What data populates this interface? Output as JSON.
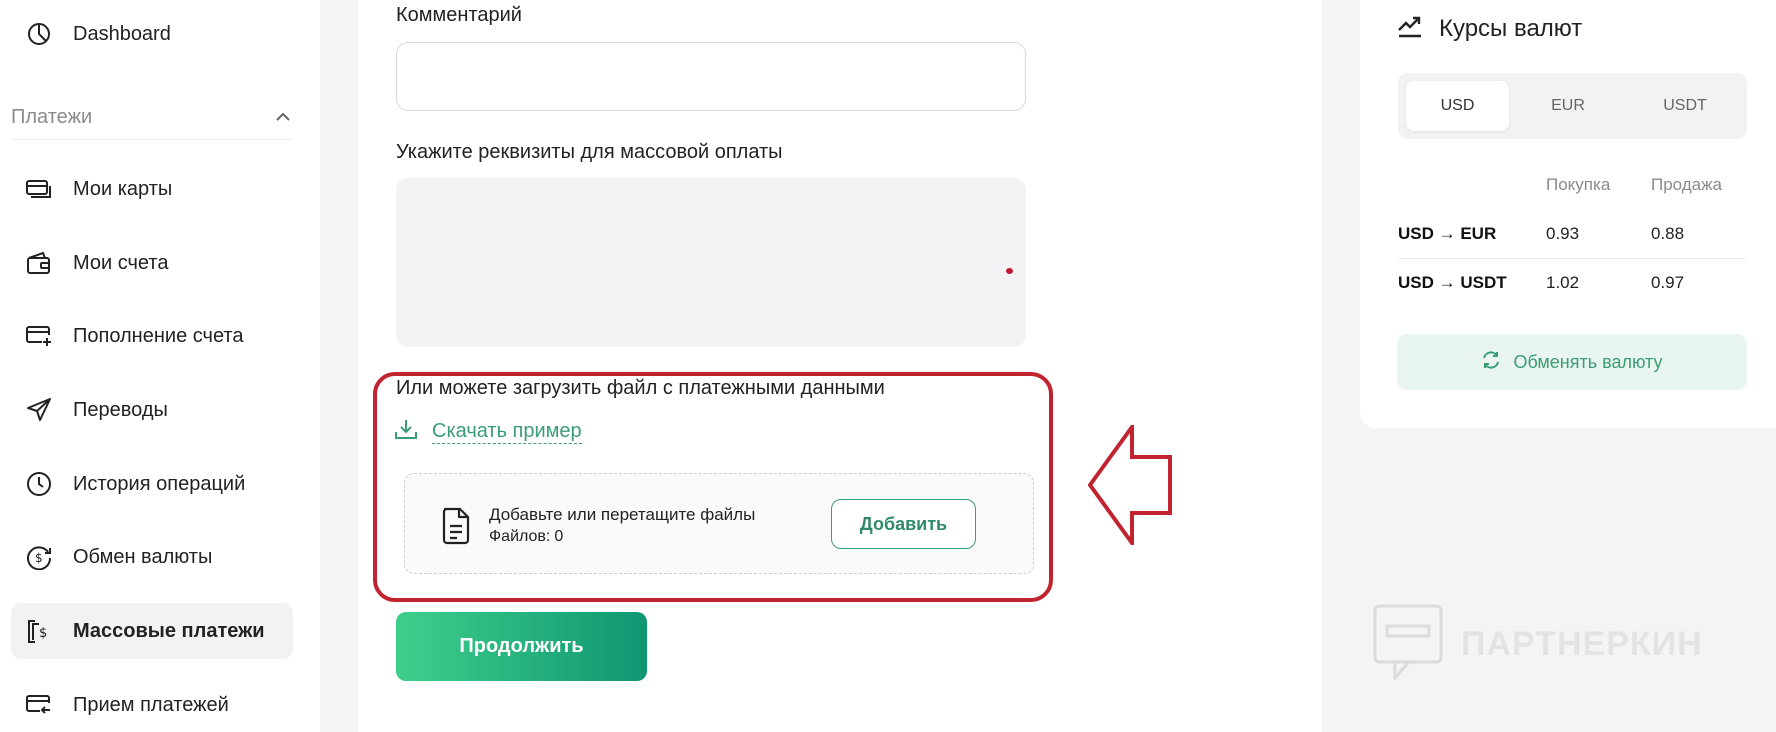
{
  "sidebar": {
    "dashboard": "Dashboard",
    "section_title": "Платежи",
    "items": [
      {
        "label": "Мои карты",
        "icon": "cards-icon"
      },
      {
        "label": "Мои счета",
        "icon": "wallet-icon"
      },
      {
        "label": "Пополнение счета",
        "icon": "card-plus-icon"
      },
      {
        "label": "Переводы",
        "icon": "send-icon"
      },
      {
        "label": "История операций",
        "icon": "clock-icon"
      },
      {
        "label": "Обмен валюты",
        "icon": "exchange-coin-icon"
      },
      {
        "label": "Массовые платежи",
        "icon": "mass-payments-icon",
        "active": true
      },
      {
        "label": "Прием платежей",
        "icon": "receive-card-icon"
      }
    ]
  },
  "form": {
    "comment_label": "Комментарий",
    "comment_value": "",
    "requisites_label": "Укажите реквизиты для массовой оплаты",
    "requisites_value": "",
    "upload_title": "Или можете загрузить файл с платежными данными",
    "download_example": "Скачать пример",
    "dropzone_text": "Добавьте или перетащите файлы",
    "files_label": "Файлов:",
    "files_count": "0",
    "add_button": "Добавить",
    "continue_button": "Продолжить"
  },
  "rates": {
    "title": "Курсы валют",
    "tabs": [
      "USD",
      "EUR",
      "USDT"
    ],
    "active_tab": "USD",
    "buy_header": "Покупка",
    "sell_header": "Продажа",
    "rows": [
      {
        "pair": "USD → EUR",
        "buy": "0.93",
        "sell": "0.88"
      },
      {
        "pair": "USD → USDT",
        "buy": "1.02",
        "sell": "0.97"
      }
    ],
    "exchange_button": "Обменять валюту"
  },
  "watermark": "ПАРТНЕРКИН",
  "colors": {
    "accent_green": "#3a9d76",
    "highlight_red": "#c1232f",
    "button_gradient_start": "#3fcf8b",
    "button_gradient_end": "#0f9672"
  }
}
